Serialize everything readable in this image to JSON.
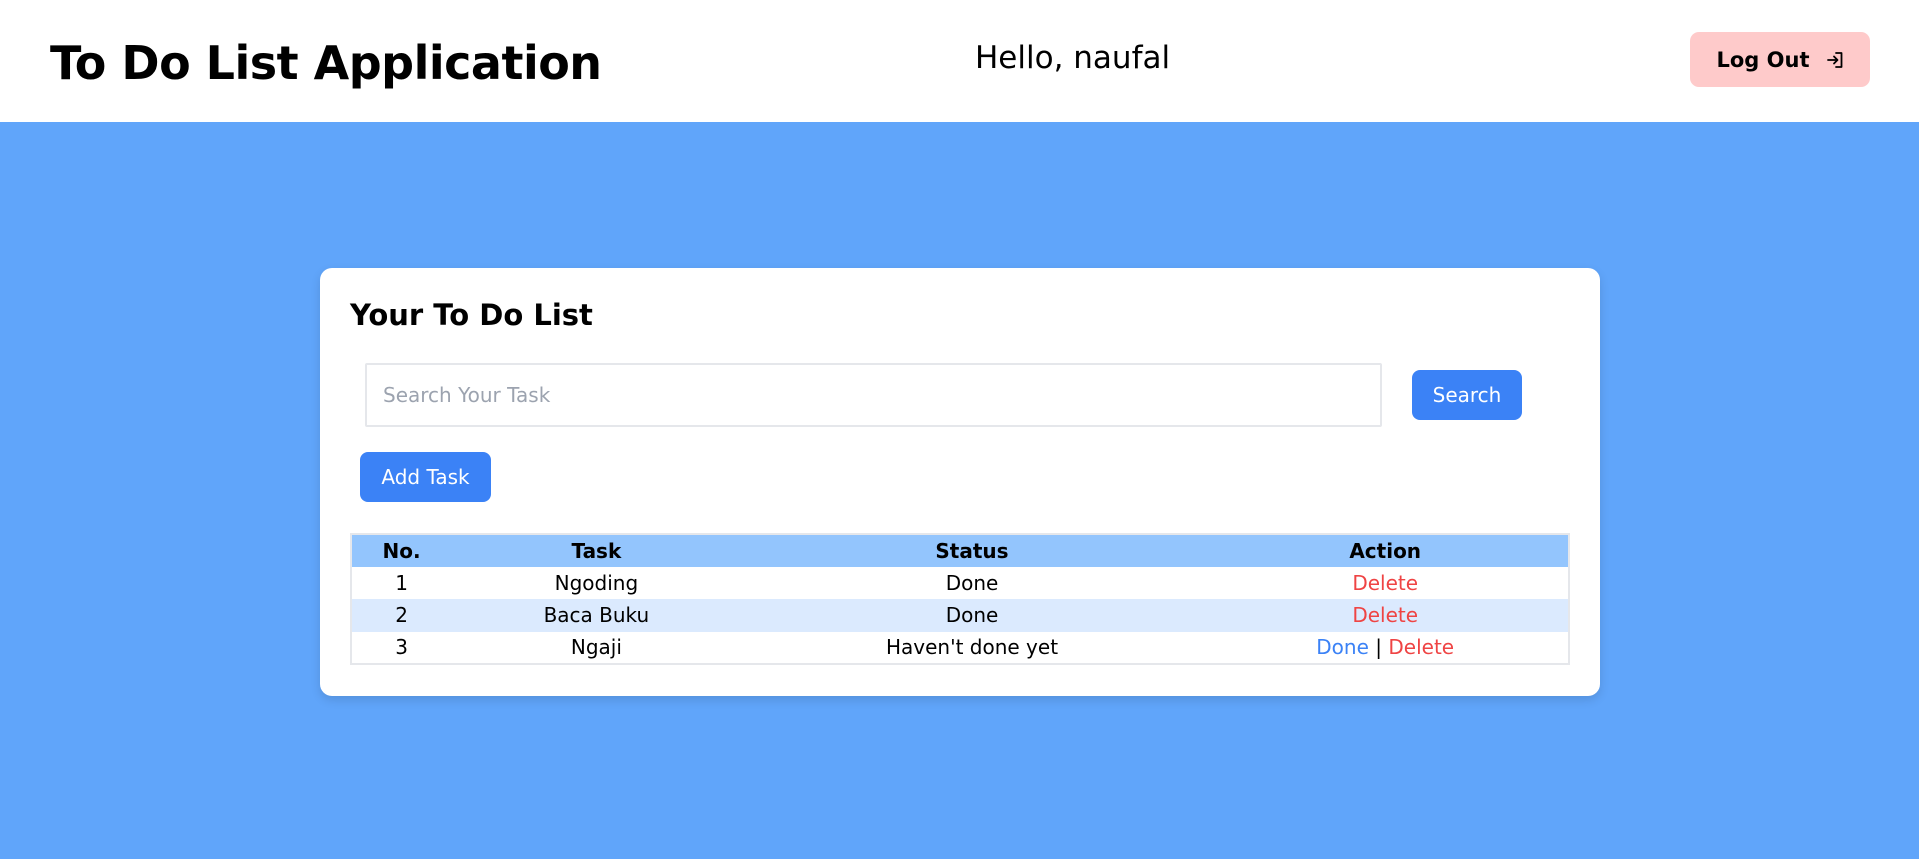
{
  "header": {
    "app_title": "To Do List Application",
    "greeting": "Hello, naufal",
    "logout_label": "Log Out",
    "logout_icon": "log-out-icon"
  },
  "main": {
    "card_title": "Your To Do List",
    "search": {
      "placeholder": "Search Your Task",
      "value": "",
      "button_label": "Search"
    },
    "add_task_label": "Add Task",
    "table": {
      "headers": {
        "no": "No.",
        "task": "Task",
        "status": "Status",
        "action": "Action"
      },
      "rows": [
        {
          "no": "1",
          "task": "Ngoding",
          "status": "Done",
          "done_label": "",
          "separator": "",
          "delete_label": "Delete"
        },
        {
          "no": "2",
          "task": "Baca Buku",
          "status": "Done",
          "done_label": "",
          "separator": "",
          "delete_label": "Delete"
        },
        {
          "no": "3",
          "task": "Ngaji",
          "status": "Haven't done yet",
          "done_label": "Done",
          "separator": "|",
          "delete_label": "Delete"
        }
      ]
    }
  },
  "colors": {
    "page_background": "#60a5fa",
    "primary_button": "#3b82f6",
    "logout_button": "#fecaca",
    "table_header": "#93c5fd",
    "table_row_alt": "#dbeafe",
    "delete_text": "#ef4444",
    "done_text": "#3b82f6"
  }
}
